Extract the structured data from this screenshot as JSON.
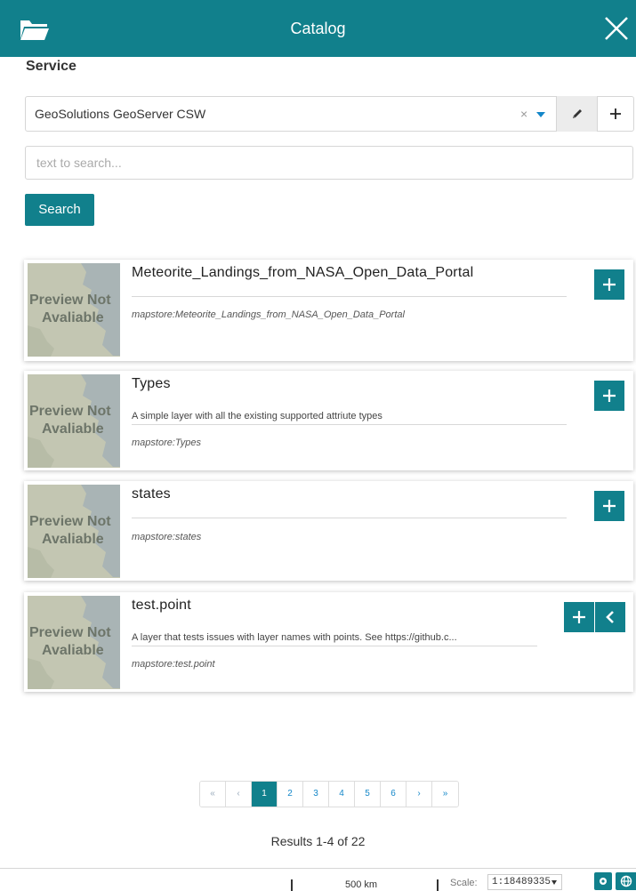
{
  "header": {
    "title": "Catalog",
    "icon": "folder-open-icon",
    "close_icon": "close-icon",
    "color": "#11808c"
  },
  "service": {
    "label": "Service",
    "selected": "GeoSolutions GeoServer CSW",
    "clear": "×"
  },
  "search": {
    "placeholder": "text to search...",
    "button_label": "Search"
  },
  "preview": {
    "line1": "Preview Not",
    "line2": "Avaliable"
  },
  "results": [
    {
      "title": "Meteorite_Landings_from_NASA_Open_Data_Portal",
      "description": "",
      "id": "mapstore:Meteorite_Landings_from_NASA_Open_Data_Portal"
    },
    {
      "title": "Types",
      "description": "A simple layer with all the existing supported attriute types",
      "id": "mapstore:Types"
    },
    {
      "title": "states",
      "description": "",
      "id": "mapstore:states"
    },
    {
      "title": "test.point",
      "description": "A layer that tests issues with layer names with points. See https://github.c...",
      "id": "mapstore:test.point"
    }
  ],
  "pagination": {
    "first": "«",
    "prev": "‹",
    "pages": [
      "1",
      "2",
      "3",
      "4",
      "5",
      "6"
    ],
    "active": "1",
    "next": "›",
    "last": "»"
  },
  "results_summary": "Results 1-4 of 22",
  "footer": {
    "scalebar": "500 km",
    "scale_label": "Scale:",
    "scale_value": "1:18489335"
  }
}
